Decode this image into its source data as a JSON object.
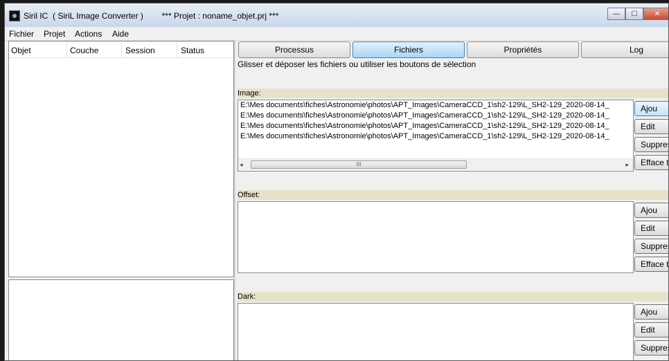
{
  "window": {
    "title": "Siril IC  ( SiriL Image Converter )        *** Projet : noname_objet.prj ***",
    "controls": {
      "minimize": "—",
      "maximize": "☐",
      "close": "✕"
    }
  },
  "menu": [
    "Fichier",
    "Projet",
    "Actions",
    "Aide"
  ],
  "object_list": {
    "columns": [
      "Objet",
      "Couche",
      "Session",
      "Status"
    ]
  },
  "tabs": [
    {
      "label": "Processus",
      "active": false
    },
    {
      "label": "Fichiers",
      "active": true
    },
    {
      "label": "Propriétés",
      "active": false
    },
    {
      "label": "Log",
      "active": false
    }
  ],
  "instructions": "Glisser et déposer les fichiers ou utiliser les boutons de sélection",
  "sections": {
    "image": {
      "label": "Image:",
      "files": [
        "E:\\Mes documents\\fiches\\Astronomie\\photos\\APT_Images\\CameraCCD_1\\sh2-129\\L_SH2-129_2020-08-14_",
        "E:\\Mes documents\\fiches\\Astronomie\\photos\\APT_Images\\CameraCCD_1\\sh2-129\\L_SH2-129_2020-08-14_",
        "E:\\Mes documents\\fiches\\Astronomie\\photos\\APT_Images\\CameraCCD_1\\sh2-129\\L_SH2-129_2020-08-14_",
        "E:\\Mes documents\\fiches\\Astronomie\\photos\\APT_Images\\CameraCCD_1\\sh2-129\\L_SH2-129_2020-08-14_"
      ],
      "buttons": [
        "Ajou",
        "Edit",
        "Suppres",
        "Efface t"
      ],
      "scrollbar": {
        "left": "◂",
        "thumb": "III",
        "right": "▸"
      }
    },
    "offset": {
      "label": "Offset:",
      "buttons": [
        "Ajou",
        "Edit",
        "Suppres",
        "Efface t"
      ]
    },
    "dark": {
      "label": "Dark:",
      "buttons": [
        "Ajou",
        "Edit",
        "Suppres"
      ]
    }
  }
}
